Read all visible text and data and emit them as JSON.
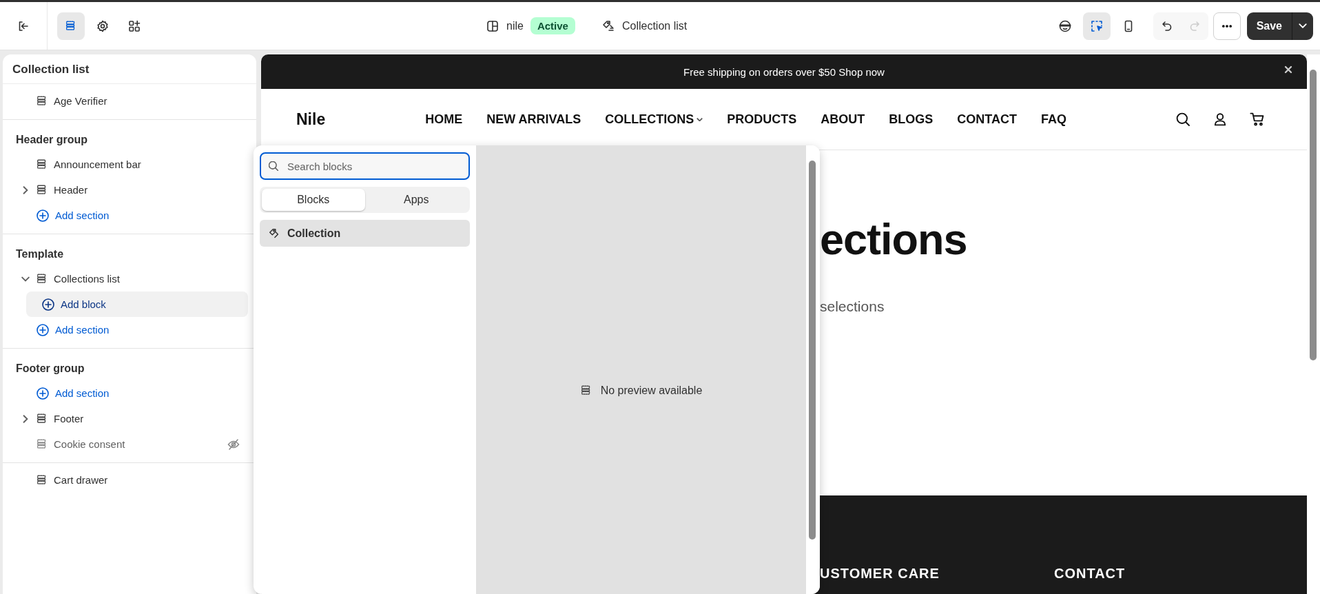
{
  "topbar": {
    "left_tools": [
      {
        "kind": "sections",
        "selected": true
      },
      {
        "kind": "settings",
        "selected": false
      },
      {
        "kind": "apps",
        "selected": false
      }
    ],
    "theme": {
      "name": "nile",
      "badge": "Active"
    },
    "page": {
      "title": "Collection list"
    },
    "right_tools": [
      {
        "kind": "inspector",
        "selected": false
      },
      {
        "kind": "select",
        "selected": true
      },
      {
        "kind": "mobile",
        "selected": false
      }
    ],
    "undo": {
      "disabled": false
    },
    "redo": {
      "disabled": true
    },
    "save": {
      "label": "Save"
    }
  },
  "sidebar": {
    "title": "Collection list",
    "groups": [
      {
        "items": [
          {
            "kind": "section",
            "label": "Age Verifier"
          }
        ]
      },
      {
        "title": "Header group",
        "items": [
          {
            "kind": "section_header",
            "label": "Announcement bar"
          },
          {
            "kind": "section_header",
            "label": "Header",
            "expanded": false
          },
          {
            "kind": "add_section",
            "label": "Add section"
          }
        ]
      },
      {
        "title": "Template",
        "items": [
          {
            "kind": "section",
            "label": "Collections list",
            "expanded": true,
            "children": [
              {
                "kind": "add_block",
                "label": "Add block"
              }
            ]
          },
          {
            "kind": "add_section",
            "label": "Add section"
          }
        ]
      },
      {
        "title": "Footer group",
        "items": [
          {
            "kind": "add_section",
            "label": "Add section"
          },
          {
            "kind": "section_footer",
            "label": "Footer",
            "expanded": false
          },
          {
            "kind": "section",
            "label": "Cookie consent",
            "hidden": true
          }
        ]
      },
      {
        "items": [
          {
            "kind": "section",
            "label": "Cart drawer"
          }
        ]
      }
    ]
  },
  "preview": {
    "announcement": "Free shipping on orders over $50 Shop now",
    "logo": "Nile",
    "nav": [
      {
        "label": "HOME"
      },
      {
        "label": "NEW ARRIVALS"
      },
      {
        "label": "COLLECTIONS",
        "dropdown": true
      },
      {
        "label": "PRODUCTS"
      },
      {
        "label": "ABOUT"
      },
      {
        "label": "BLOGS"
      },
      {
        "label": "CONTACT"
      },
      {
        "label": "FAQ"
      }
    ],
    "heading": "ections",
    "subheading": "selections",
    "footer_headings": [
      "USTOMER CARE",
      "CONTACT"
    ]
  },
  "block_picker": {
    "search": {
      "placeholder": "Search blocks"
    },
    "tabs": [
      {
        "label": "Blocks",
        "selected": true
      },
      {
        "label": "Apps",
        "selected": false
      }
    ],
    "blocks": [
      {
        "label": "Collection",
        "selected": true
      }
    ],
    "preview_message": "No preview available"
  }
}
